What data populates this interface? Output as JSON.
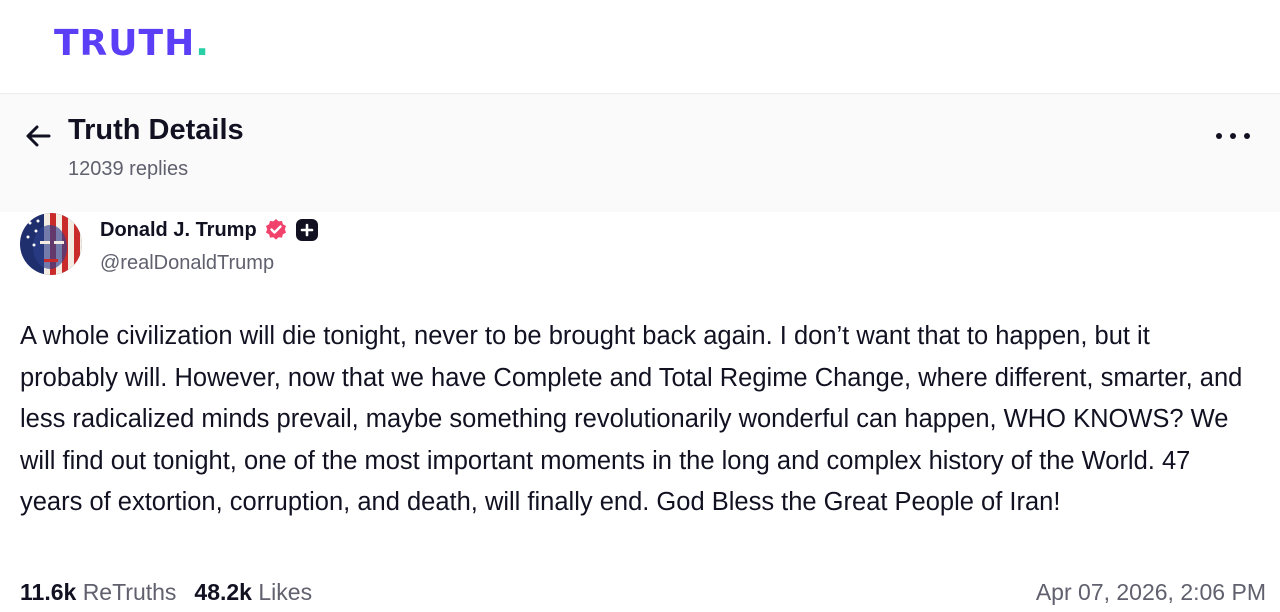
{
  "logo": {
    "text": "TRUTH",
    "dot": ".",
    "color": "#5b3ff6",
    "dot_color": "#28d0a8"
  },
  "header": {
    "back_icon": "arrow-left-icon",
    "title": "Truth Details",
    "replies": "12039 replies",
    "more_icon": "more-horizontal-icon"
  },
  "post": {
    "author": {
      "name": "Donald J. Trump",
      "handle": "@realDonaldTrump",
      "verified_icon": "verified-badge-icon",
      "verified_color": "#f0426a",
      "plus_icon": "plus-badge-icon"
    },
    "text": "A whole civilization will die tonight, never to be brought back again. I don’t want that to happen, but it probably will. However, now that we have Complete and Total Regime Change, where different, smarter, and less radicalized minds prevail, maybe something revolutionarily wonderful can happen, WHO KNOWS? We will find out tonight, one of the most important moments in the long and complex history of the World. 47 years of extortion, corruption, and death, will finally end. God Bless the Great People of Iran!",
    "retruths_count": "11.6k",
    "retruths_label": "ReTruths",
    "likes_count": "48.2k",
    "likes_label": "Likes",
    "timestamp": "Apr 07, 2026, 2:06 PM"
  }
}
